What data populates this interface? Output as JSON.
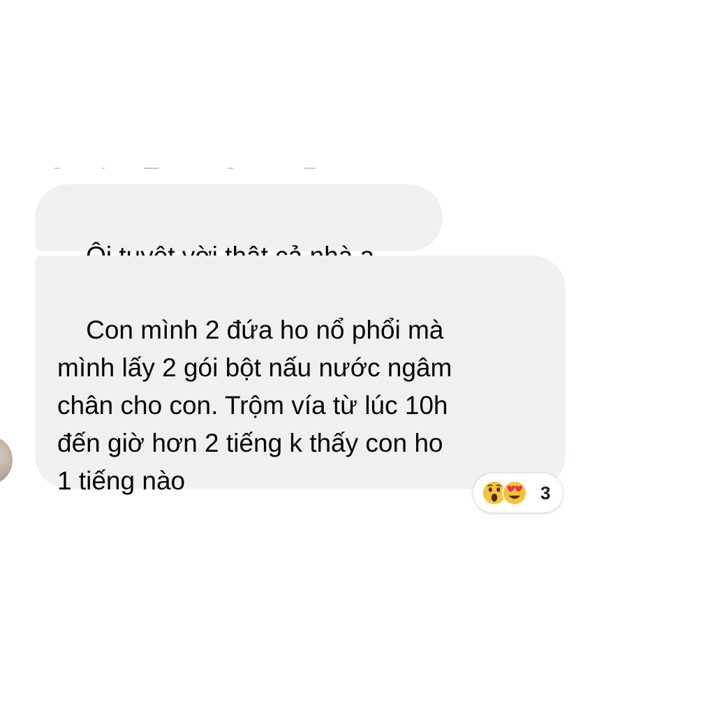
{
  "messages": [
    {
      "text": "Ôi tuyệt vời thật cả nhà ạ."
    },
    {
      "text": "Con mình 2 đứa ho nổ phổi mà\nmình lấy 2 gói bột nấu nước ngâm\nchân cho con. Trộm vía từ lúc 10h\nđến giờ hơn 2 tiếng k thấy con ho\n1 tiếng nào"
    }
  ],
  "reactions": {
    "icons": [
      "wow-emoji-icon",
      "heart-eyes-emoji-icon"
    ],
    "count": "3"
  },
  "colors": {
    "bubble": "#eff0f2",
    "text": "#050505",
    "emoji_face": "#f7c33d",
    "emoji_heart": "#e8334a"
  }
}
